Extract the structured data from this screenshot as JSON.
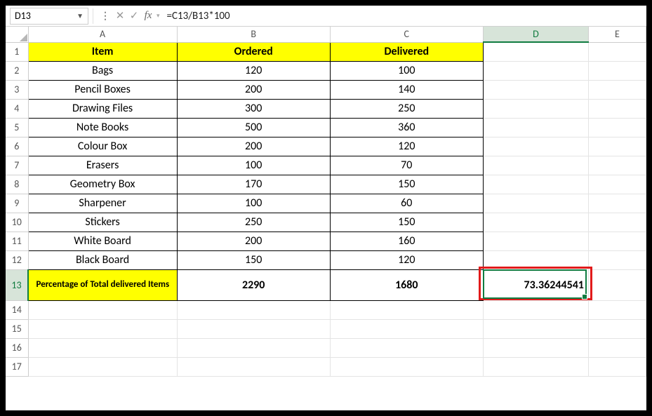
{
  "name_box": "D13",
  "formula": "=C13/B13*100",
  "columns": [
    "A",
    "B",
    "C",
    "D",
    "E"
  ],
  "headers": {
    "A": "Item",
    "B": "Ordered",
    "C": "Delivered"
  },
  "rows": [
    {
      "n": 1
    },
    {
      "n": 2,
      "item": "Bags",
      "ordered": "120",
      "delivered": "100"
    },
    {
      "n": 3,
      "item": "Pencil Boxes",
      "ordered": "200",
      "delivered": "140"
    },
    {
      "n": 4,
      "item": "Drawing Files",
      "ordered": "300",
      "delivered": "250"
    },
    {
      "n": 5,
      "item": "Note Books",
      "ordered": "500",
      "delivered": "360"
    },
    {
      "n": 6,
      "item": "Colour Box",
      "ordered": "200",
      "delivered": "120"
    },
    {
      "n": 7,
      "item": "Erasers",
      "ordered": "100",
      "delivered": "70"
    },
    {
      "n": 8,
      "item": "Geometry Box",
      "ordered": "170",
      "delivered": "150"
    },
    {
      "n": 9,
      "item": "Sharpener",
      "ordered": "100",
      "delivered": "60"
    },
    {
      "n": 10,
      "item": "Stickers",
      "ordered": "250",
      "delivered": "150"
    },
    {
      "n": 11,
      "item": "White Board",
      "ordered": "200",
      "delivered": "160"
    },
    {
      "n": 12,
      "item": "Black Board",
      "ordered": "150",
      "delivered": "120"
    }
  ],
  "total": {
    "n": 13,
    "label": "Percentage of Total delivered Items",
    "ordered": "2290",
    "delivered": "1680",
    "result": "73.36244541"
  },
  "blank_rows": [
    14,
    15,
    16,
    17
  ],
  "active": {
    "col": "D",
    "row": 13
  },
  "colors": {
    "highlight": "#ffff00",
    "selection": "#107c41",
    "callout": "#e11b1b"
  },
  "chart_data": {
    "type": "table",
    "title": "Percentage of Total delivered Items",
    "columns": [
      "Item",
      "Ordered",
      "Delivered"
    ],
    "rows": [
      [
        "Bags",
        120,
        100
      ],
      [
        "Pencil Boxes",
        200,
        140
      ],
      [
        "Drawing Files",
        300,
        250
      ],
      [
        "Note Books",
        500,
        360
      ],
      [
        "Colour Box",
        200,
        120
      ],
      [
        "Erasers",
        100,
        70
      ],
      [
        "Geometry Box",
        170,
        150
      ],
      [
        "Sharpener",
        100,
        60
      ],
      [
        "Stickers",
        250,
        150
      ],
      [
        "White Board",
        200,
        160
      ],
      [
        "Black Board",
        150,
        120
      ]
    ],
    "totals": {
      "Ordered": 2290,
      "Delivered": 1680
    },
    "percentage_delivered": 73.36244541
  }
}
